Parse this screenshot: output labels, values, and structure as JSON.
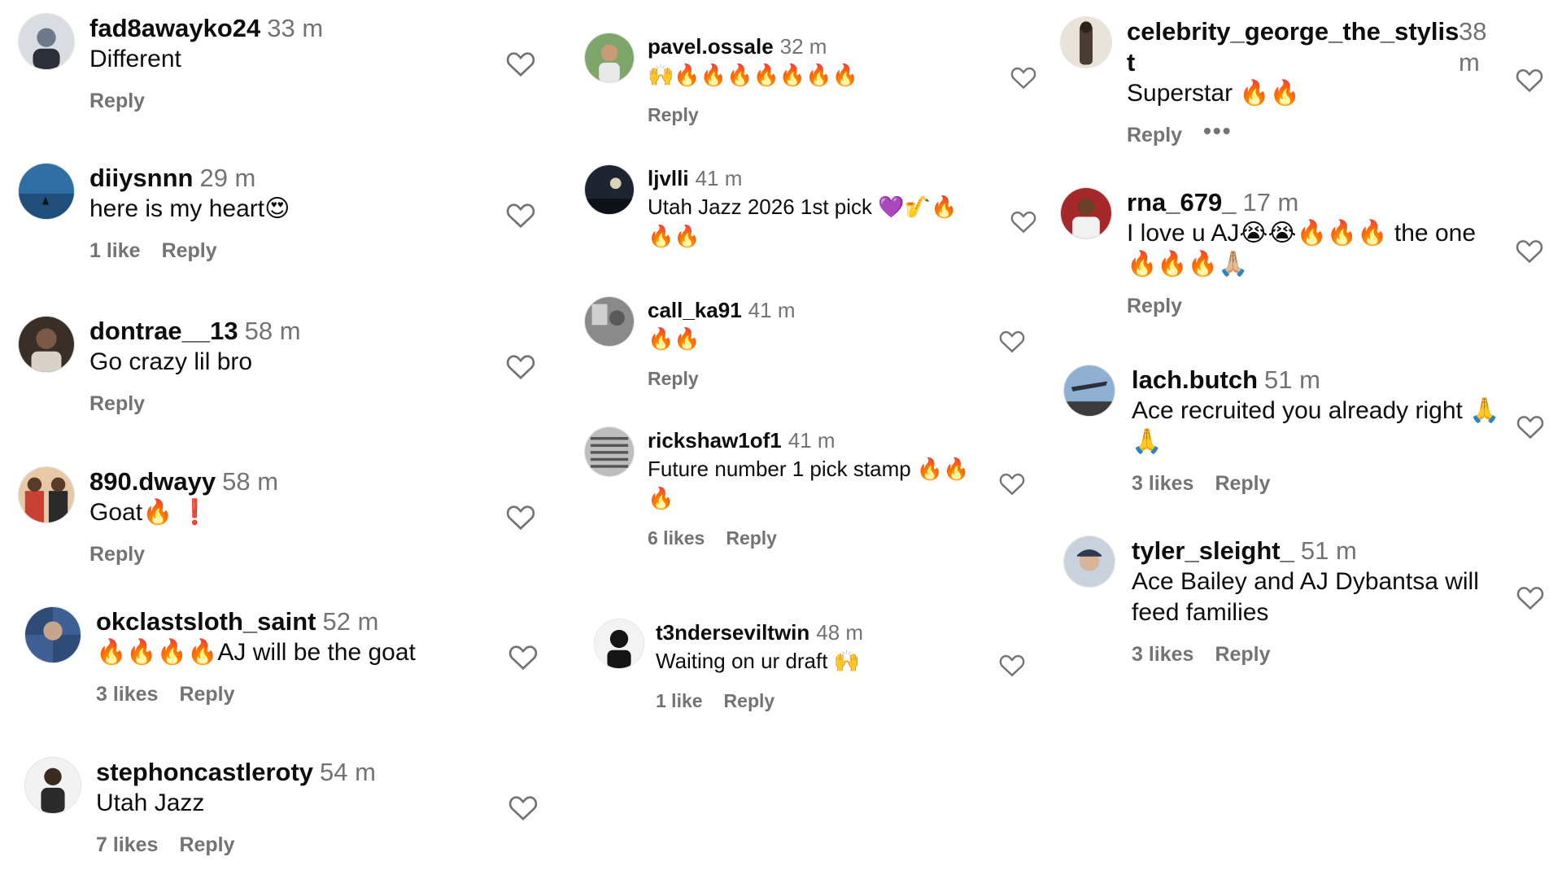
{
  "columns": [
    [
      {
        "user": "fad8awayko24",
        "time": "33 m",
        "text": "Different",
        "likes": "",
        "reply": "Reply",
        "avatar_color": "#6d7a8b"
      },
      {
        "user": "diiysnnn",
        "time": "29 m",
        "text": "here is my heart😍",
        "likes": "1 like",
        "reply": "Reply",
        "avatar_color": "#2f6fa3"
      },
      {
        "user": "dontrae__13",
        "time": "58 m",
        "text": "Go crazy lil bro",
        "likes": "",
        "reply": "Reply",
        "avatar_color": "#3a2e28"
      },
      {
        "user": "890.dwayy",
        "time": "58 m",
        "text": "Goat🔥 ❗",
        "likes": "",
        "reply": "Reply",
        "avatar_color": "#b5533a"
      },
      {
        "user": "okclastsloth_saint",
        "time": "52 m",
        "text": "🔥🔥🔥🔥AJ will be the goat",
        "likes": "3 likes",
        "reply": "Reply",
        "avatar_color": "#3f5f95"
      },
      {
        "user": "stephoncastleroty",
        "time": "54 m",
        "text": "Utah Jazz",
        "likes": "7 likes",
        "reply": "Reply",
        "avatar_color": "#2b2b2b"
      }
    ],
    [
      {
        "user": "pavel.ossale",
        "time": "32 m",
        "text": "🙌🔥🔥🔥🔥🔥🔥🔥",
        "likes": "",
        "reply": "Reply",
        "avatar_color": "#7fa66a"
      },
      {
        "user": "ljvlli",
        "time": "41 m",
        "text": "Utah Jazz 2026 1st pick 💜🎷🔥",
        "text2": "🔥🔥",
        "likes": "",
        "reply": "Reply",
        "avatar_color": "#1e2530"
      },
      {
        "user": "call_ka91",
        "time": "41 m",
        "text": "🔥🔥",
        "likes": "",
        "reply": "Reply",
        "avatar_color": "#8a8a8a"
      },
      {
        "user": "rickshaw1of1",
        "time": "41 m",
        "text": "Future number 1 pick stamp 🔥🔥",
        "text2": "🔥",
        "likes": "6 likes",
        "reply": "Reply",
        "avatar_color": "#9a9a9a"
      },
      {
        "user": "t3nderseviltwin",
        "time": "48 m",
        "text": "Waiting on ur draft 🙌",
        "likes": "1 like",
        "reply": "Reply",
        "avatar_color": "#151515"
      }
    ],
    [
      {
        "user": "celebrity_george_the_stylis",
        "user2": "t",
        "time": "38",
        "time2": "m",
        "text": "Superstar 🔥🔥",
        "likes": "",
        "reply": "Reply",
        "more": "•••",
        "avatar_color": "#4a3d33"
      },
      {
        "user": "rna_679_",
        "time": "17 m",
        "text": "I love u AJ😭😭🔥🔥🔥 the one",
        "text2": "🔥🔥🔥🙏🏼",
        "likes": "",
        "reply": "Reply",
        "avatar_color": "#a7282a"
      },
      {
        "user": "lach.butch",
        "time": "51 m",
        "text": "Ace recruited you already right 🙏",
        "text2": "🙏",
        "likes": "3 likes",
        "reply": "Reply",
        "avatar_color": "#5b7ea8"
      },
      {
        "user": "tyler_sleight_",
        "time": "51 m",
        "text": "Ace Bailey and AJ Dybantsa will",
        "text2": "feed families",
        "likes": "3 likes",
        "reply": "Reply",
        "avatar_color": "#6c7a88"
      }
    ]
  ]
}
